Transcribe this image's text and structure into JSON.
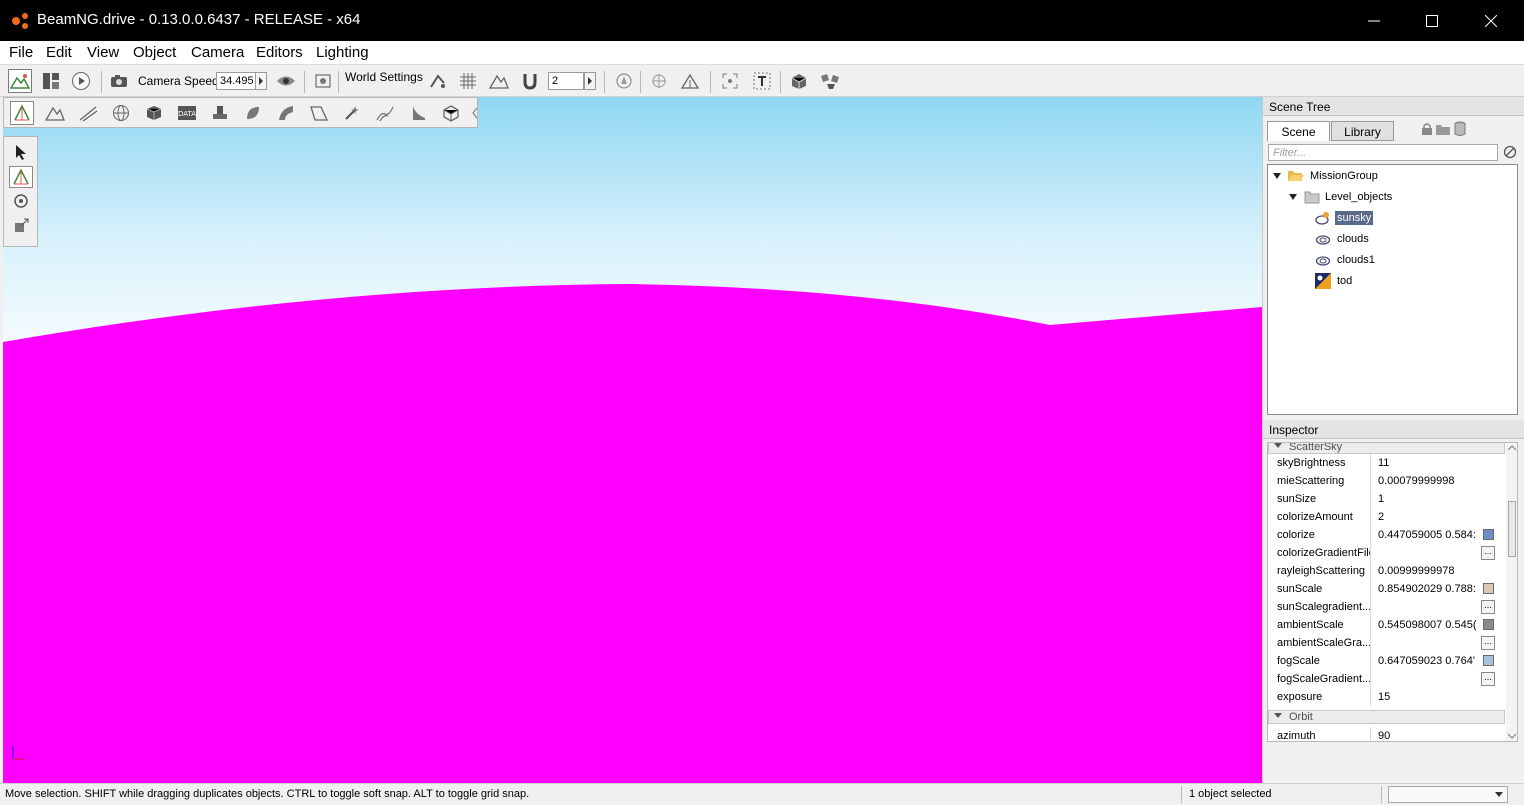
{
  "window": {
    "title": "BeamNG.drive - 0.13.0.0.6437 - RELEASE - x64"
  },
  "menu": [
    "File",
    "Edit",
    "View",
    "Object",
    "Camera",
    "Editors",
    "Lighting"
  ],
  "toolbar": {
    "camera_speed_label": "Camera Speed",
    "camera_speed_value": "34.495",
    "world_settings_label": "World Settings",
    "grid_size_value": "2"
  },
  "scene_tree": {
    "header": "Scene Tree",
    "tabs": [
      "Scene",
      "Library"
    ],
    "filter_placeholder": "Filter...",
    "items": [
      {
        "label": "MissionGroup"
      },
      {
        "label": "Level_objects"
      },
      {
        "label": "sunsky",
        "selected": true
      },
      {
        "label": "clouds"
      },
      {
        "label": "clouds1"
      },
      {
        "label": "tod"
      }
    ]
  },
  "inspector": {
    "header": "Inspector",
    "groups": [
      "ScatterSky",
      "Orbit"
    ],
    "properties": [
      {
        "name": "skyBrightness",
        "value": "11"
      },
      {
        "name": "mieScattering",
        "value": "0.00079999998"
      },
      {
        "name": "sunSize",
        "value": "1"
      },
      {
        "name": "colorizeAmount",
        "value": "2"
      },
      {
        "name": "colorize",
        "value": "0.447059005 0.584:",
        "swatch": "#6f8ec8"
      },
      {
        "name": "colorizeGradientFile",
        "value": ""
      },
      {
        "name": "rayleighScattering",
        "value": "0.00999999978"
      },
      {
        "name": "sunScale",
        "value": "0.854902029 0.788:",
        "swatch": "#dac8b8"
      },
      {
        "name": "sunScalegradient...",
        "value": ""
      },
      {
        "name": "ambientScale",
        "value": "0.545098007 0.545(",
        "swatch": "#8b8b8b"
      },
      {
        "name": "ambientScaleGra...",
        "value": ""
      },
      {
        "name": "fogScale",
        "value": "0.647059023 0.764'",
        "swatch": "#a5c3e0"
      },
      {
        "name": "fogScaleGradient...",
        "value": ""
      },
      {
        "name": "exposure",
        "value": "15"
      }
    ],
    "orbit_properties": [
      {
        "name": "azimuth",
        "value": "90"
      }
    ]
  },
  "status": {
    "message": "Move selection.  SHIFT while dragging duplicates objects.  CTRL to toggle soft snap.  ALT to toggle grid snap.",
    "selection": "1 object selected"
  },
  "colors": {
    "terrain": "#ff00ff",
    "sky_top": "#9edcf4",
    "sky_horizon": "#f4fbfe",
    "selection": "#5a6a8a"
  }
}
